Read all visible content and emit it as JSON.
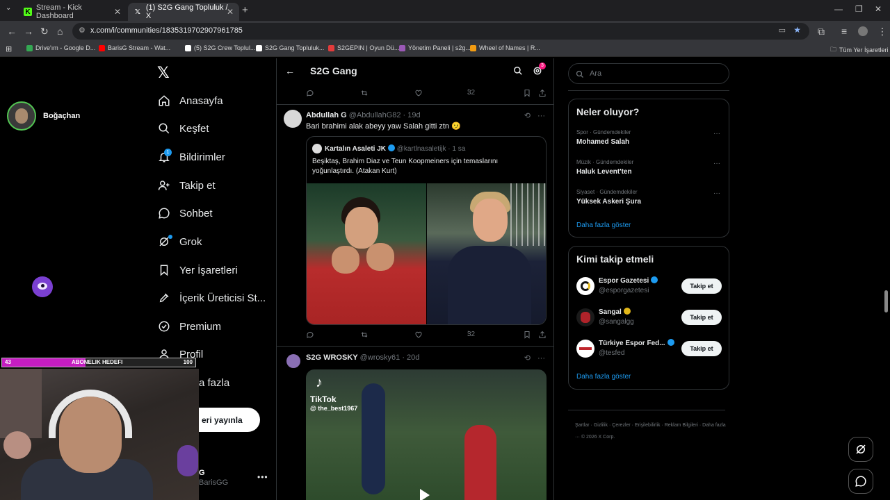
{
  "browser": {
    "tabs": [
      {
        "title": "Stream - Kick Dashboard",
        "favicon": "kick-icon",
        "color": "#53fc18"
      },
      {
        "title": "(1) S2G Gang Topluluk / X",
        "favicon": "x-icon",
        "color": "#ffffff"
      }
    ],
    "url": "x.com/i/communities/1835319702907961785",
    "bookmarks": [
      {
        "label": "Drive'ım - Google D...",
        "color": "#34a853"
      },
      {
        "label": "BarisG Stream - Wat...",
        "color": "#ff0000"
      },
      {
        "label": "(5) S2G Crew Toplul...",
        "color": "#ffffff"
      },
      {
        "label": "S2G Gang Topluluk...",
        "color": "#ffffff"
      },
      {
        "label": "S2GEPIN | Oyun Dü...",
        "color": "#e23b3b"
      },
      {
        "label": "Yönetim Paneli | s2g...",
        "color": "#9b59b6"
      },
      {
        "label": "Wheel of Names | R...",
        "color": "#f39c12"
      }
    ],
    "all_bookmarks": "Tüm Yer İşaretleri"
  },
  "stream": {
    "streamer_name": "Boğaçhan",
    "goal": {
      "current": "43",
      "title": "ABONELIK HEDEFI",
      "target": "100",
      "progress": 0.43
    }
  },
  "nav": {
    "items": [
      {
        "label": "Anasayfa",
        "icon": "home-icon"
      },
      {
        "label": "Keşfet",
        "icon": "search-icon"
      },
      {
        "label": "Bildirimler",
        "icon": "bell-icon"
      },
      {
        "label": "Takip et",
        "icon": "person-add-icon"
      },
      {
        "label": "Sohbet",
        "icon": "chat-icon"
      },
      {
        "label": "Grok",
        "icon": "grok-icon"
      },
      {
        "label": "Yer İşaretleri",
        "icon": "bookmark-icon"
      },
      {
        "label": "İçerik Üreticisi St...",
        "icon": "rocket-icon"
      },
      {
        "label": "Premium",
        "icon": "premium-icon"
      },
      {
        "label": "Profil",
        "icon": "profile-icon"
      },
      {
        "label": "a fazla",
        "icon": "more-icon"
      }
    ],
    "notif_count": "1",
    "post_button": "eri yayınla",
    "profile_name": "G",
    "profile_handle": "BarisGG"
  },
  "feed": {
    "community_title": "S2G Gang",
    "settings_badge": "3",
    "top_views": "32",
    "post1": {
      "author": "Abdullah G",
      "handle": "@AbdullahG82 · 19d",
      "text": "Bari brahimi alak abeyy yaw Salah gitti ztn 🫤",
      "quote_author": "Kartalın Asaleti JK",
      "quote_handle": "@kartlnasaletijk · 1 sa",
      "quote_text": "Beşiktaş, Brahim Diaz ve Teun Koopmeiners için temaslarını yoğunlaştırdı. (Atakan Kurt)",
      "views": "32"
    },
    "post2": {
      "author": "S2G WROSKY",
      "handle": "@wrosky61 · 20d",
      "tiktok_label": "TikTok",
      "tiktok_user": "@ the_best1967"
    }
  },
  "sidebar": {
    "search_placeholder": "Ara",
    "trends_title": "Neler oluyor?",
    "trends": [
      {
        "category": "Spor · Gündemdekiler",
        "name": "Mohamed Salah"
      },
      {
        "category": "Müzik · Gündemdekiler",
        "name": "Haluk Levent'ten"
      },
      {
        "category": "Siyaset · Gündemdekiler",
        "name": "Yüksek Askeri Şura"
      }
    ],
    "show_more": "Daha fazla göster",
    "wtf_title": "Kimi takip etmeli",
    "wtf": [
      {
        "name": "Espor Gazetesi",
        "handle": "@esporgazetesi",
        "button": "Takip et"
      },
      {
        "name": "Sangal",
        "handle": "@sangalgg",
        "button": "Takip et"
      },
      {
        "name": "Türkiye Espor Fed...",
        "handle": "@tesfed",
        "button": "Takip et"
      }
    ],
    "wtf_show_more": "Daha fazla göster",
    "footer": "Şartlar · Gizlilik · Çerezler · Erişilebilirlik · Reklam Bilgileri · Daha fazla ··· © 2026 X Corp."
  }
}
